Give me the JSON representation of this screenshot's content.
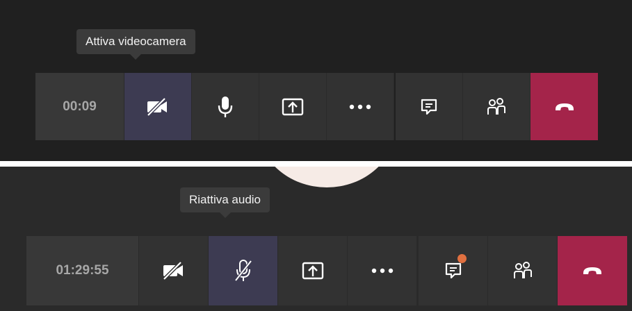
{
  "colors": {
    "toolbar_bg": "#323232",
    "active_bg": "#3d3b52",
    "hangup_bg": "#a4244a",
    "notification_dot": "#e07040"
  },
  "top_toolbar": {
    "tooltip": "Attiva videocamera",
    "timer": "00:09",
    "buttons": [
      {
        "icon": "camera-off-icon",
        "state": "active"
      },
      {
        "icon": "microphone-icon"
      },
      {
        "icon": "share-screen-icon"
      },
      {
        "icon": "more-options-icon"
      },
      {
        "icon": "chat-icon"
      },
      {
        "icon": "participants-icon"
      },
      {
        "icon": "hang-up-icon"
      }
    ]
  },
  "bottom_toolbar": {
    "tooltip": "Riattiva audio",
    "timer": "01:29:55",
    "buttons": [
      {
        "icon": "camera-off-icon"
      },
      {
        "icon": "microphone-off-icon",
        "state": "active"
      },
      {
        "icon": "share-screen-icon"
      },
      {
        "icon": "more-options-icon"
      },
      {
        "icon": "chat-icon",
        "badge": "notification-dot"
      },
      {
        "icon": "participants-icon"
      },
      {
        "icon": "hang-up-icon"
      }
    ]
  }
}
